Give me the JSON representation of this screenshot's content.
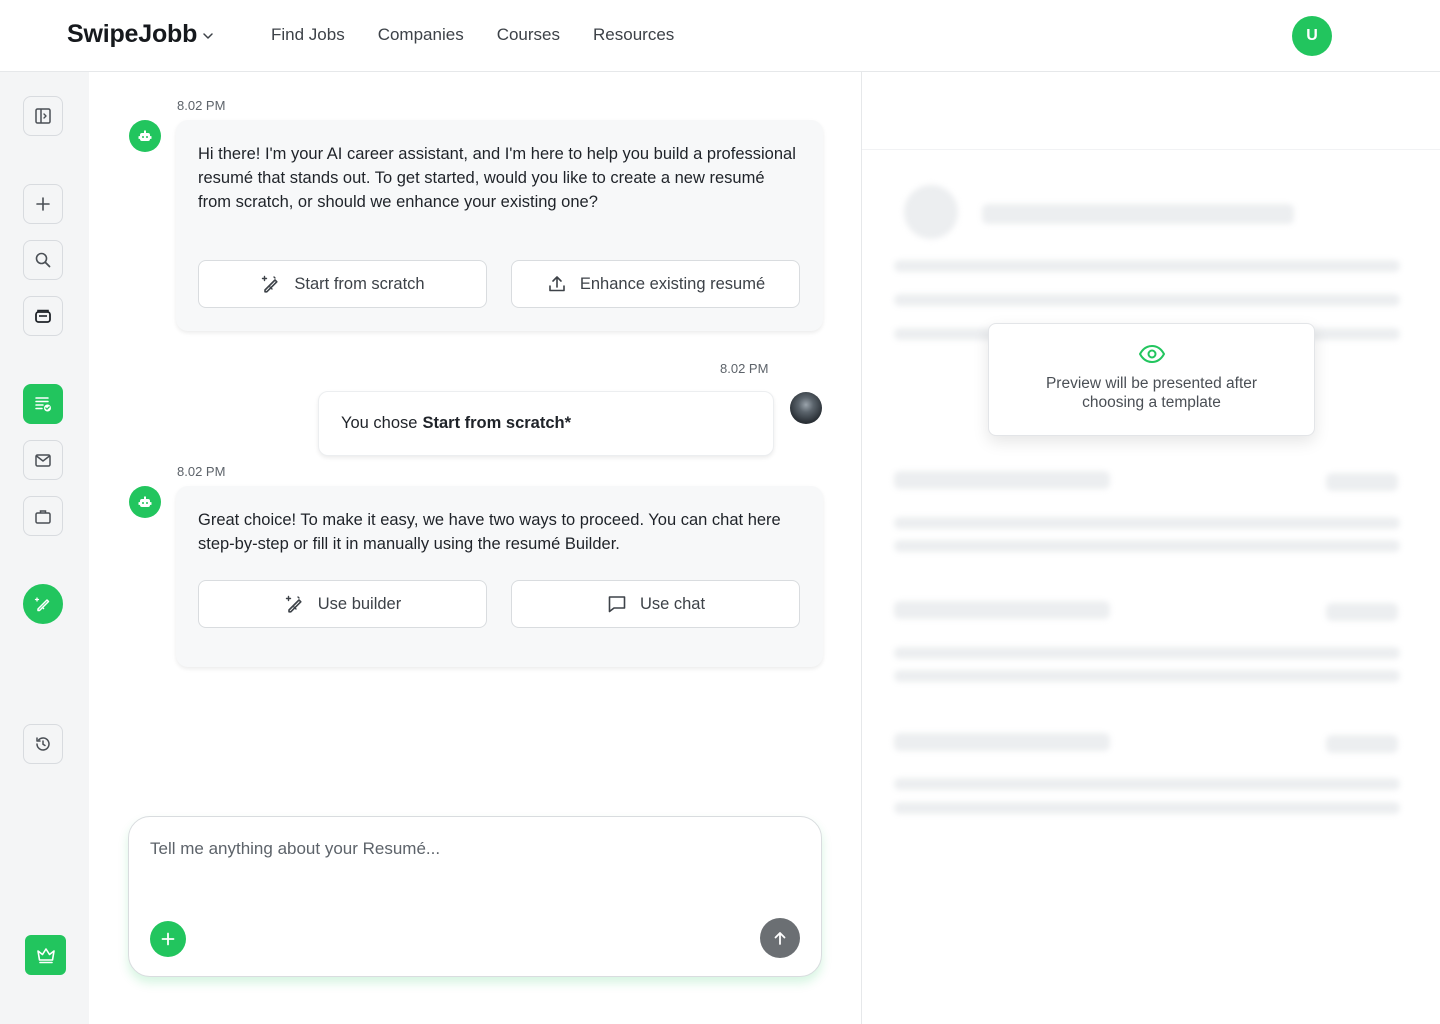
{
  "header": {
    "brand": "SwipeJobb",
    "nav": [
      "Find Jobs",
      "Companies",
      "Courses",
      "Resources"
    ],
    "user_initial": "U"
  },
  "sidebar": {
    "items": [
      {
        "icon": "sidebar-toggle-icon"
      },
      {
        "icon": "plus-icon"
      },
      {
        "icon": "search-icon"
      },
      {
        "icon": "archive-icon"
      },
      {
        "icon": "resume-check-icon",
        "active": true
      },
      {
        "icon": "mail-icon"
      },
      {
        "icon": "briefcase-icon"
      },
      {
        "icon": "pen-sparkle-icon"
      },
      {
        "icon": "history-icon"
      },
      {
        "icon": "crown-icon"
      }
    ],
    "accent": "#22c55e"
  },
  "chat": {
    "messages": [
      {
        "sender": "bot",
        "time": "8.02 PM",
        "text": "Hi there! I'm your AI career assistant, and I'm here to help you build a professional resumé that stands out. To get started, would you like to create a new resumé from scratch, or should we enhance your existing one?",
        "options": [
          {
            "label": "Start from scratch",
            "icon": "pen-sparkle-icon"
          },
          {
            "label": "Enhance existing resumé",
            "icon": "upload-icon"
          }
        ]
      },
      {
        "sender": "user",
        "time": "8.02 PM",
        "prefix": "You chose",
        "choice": "Start from scratch*"
      },
      {
        "sender": "bot",
        "time": "8.02 PM",
        "text": "Great choice! To make it easy, we have two ways to proceed. You can chat here step-by-step or fill it in manually using the resumé Builder.",
        "options": [
          {
            "label": "Use builder",
            "icon": "pen-sparkle-icon"
          },
          {
            "label": "Use chat",
            "icon": "chat-bubble-icon"
          }
        ]
      }
    ]
  },
  "composer": {
    "placeholder": "Tell me anything about your Resumé...",
    "value": ""
  },
  "preview": {
    "message": "Preview will be presented after choosing a template"
  }
}
